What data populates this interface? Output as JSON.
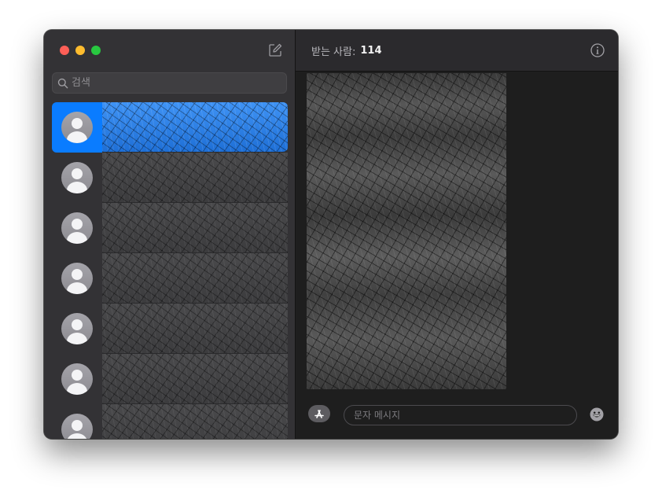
{
  "window": {
    "traffic_lights": [
      "close",
      "minimize",
      "zoom"
    ]
  },
  "sidebar": {
    "compose_icon": "compose-icon",
    "search": {
      "placeholder": "검색",
      "icon": "search-icon"
    },
    "conversations": [
      {
        "selected": true,
        "name": "",
        "preview": ""
      },
      {
        "selected": false,
        "name": "",
        "preview": ""
      },
      {
        "selected": false,
        "name": "",
        "preview": ""
      },
      {
        "selected": false,
        "name": "",
        "preview": ""
      },
      {
        "selected": false,
        "name": "",
        "preview": ""
      },
      {
        "selected": false,
        "name": "",
        "preview": ""
      },
      {
        "selected": false,
        "name": "",
        "preview": ""
      }
    ]
  },
  "header": {
    "to_label": "받는 사람:",
    "to_value": "114",
    "info_icon": "info-icon"
  },
  "composer": {
    "placeholder": "문자 메시지",
    "app_icon": "app-store-icon",
    "emoji_icon": "emoji-icon"
  },
  "colors": {
    "accent": "#0a7cff",
    "close": "#fe5f57",
    "minimize": "#febc2e",
    "zoom": "#28c840"
  }
}
